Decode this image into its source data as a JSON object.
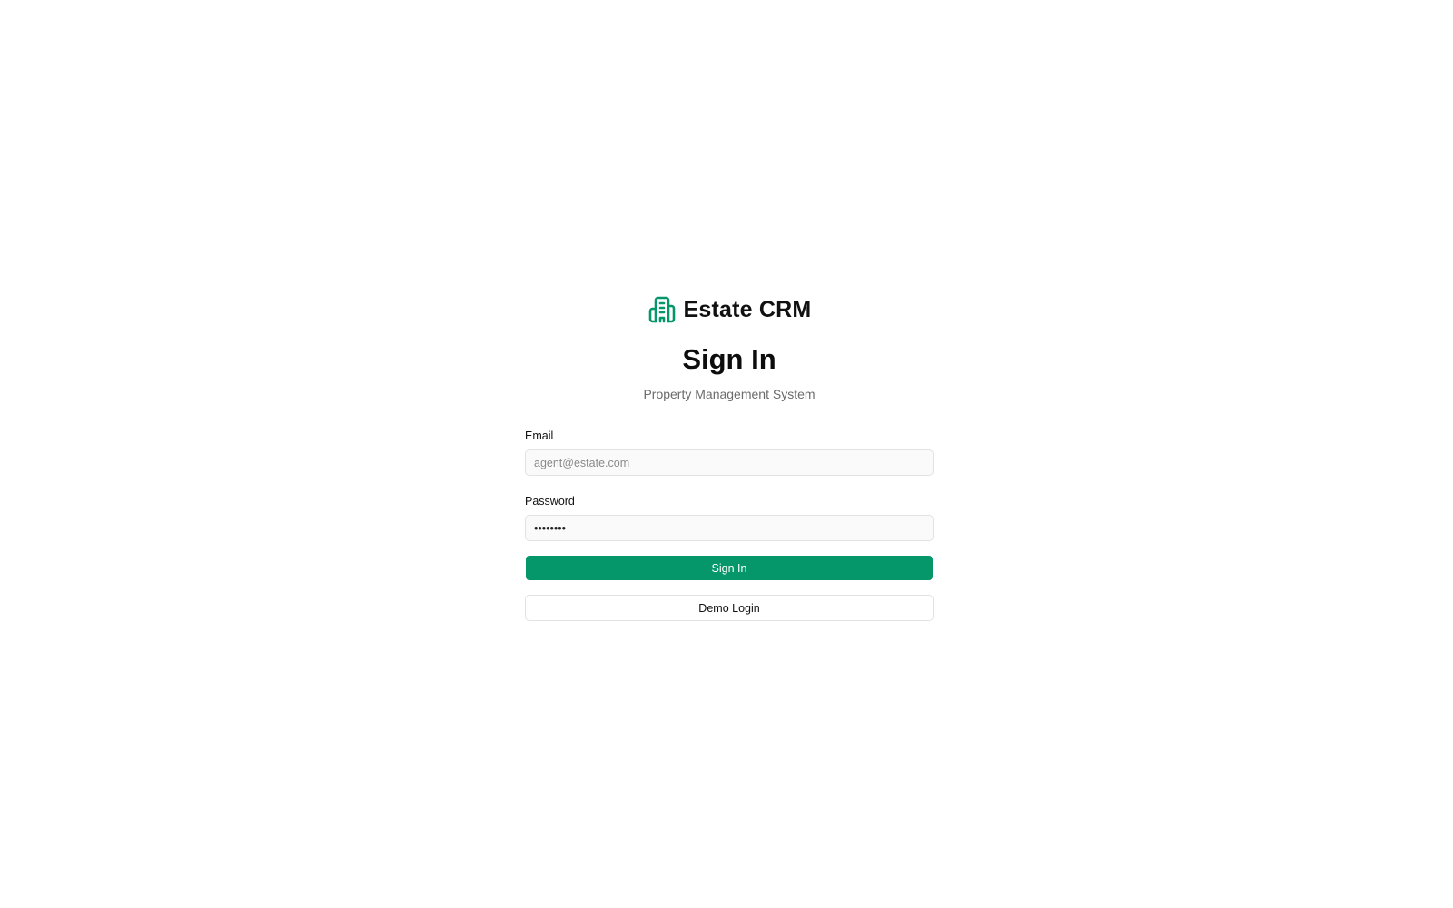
{
  "brand": {
    "name": "Estate CRM",
    "icon": "building-icon",
    "accent_color": "#059669"
  },
  "header": {
    "title": "Sign In",
    "subtitle": "Property Management System"
  },
  "form": {
    "email": {
      "label": "Email",
      "value": "",
      "placeholder": "agent@estate.com"
    },
    "password": {
      "label": "Password",
      "value": "password",
      "placeholder": ""
    },
    "submit_label": "Sign In",
    "demo_label": "Demo Login"
  },
  "colors": {
    "primary": "#059669",
    "text": "#111111",
    "muted": "#6b6b6b",
    "border": "#e2e2e2"
  }
}
